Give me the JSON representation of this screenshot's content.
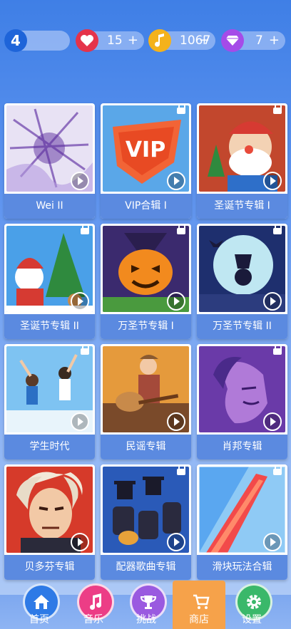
{
  "status": {
    "level": "4",
    "level_progress": 0.3,
    "lives": "15",
    "coins": "1067",
    "gems": "7",
    "plus": "+"
  },
  "albums": [
    {
      "title": "Wei II",
      "locked": false
    },
    {
      "title": "VIP合辑 I",
      "locked": true
    },
    {
      "title": "圣诞节专辑 I",
      "locked": true
    },
    {
      "title": "圣诞节专辑 II",
      "locked": true
    },
    {
      "title": "万圣节专辑 I",
      "locked": true
    },
    {
      "title": "万圣节专辑 II",
      "locked": true
    },
    {
      "title": "学生时代",
      "locked": true
    },
    {
      "title": "民谣专辑",
      "locked": false
    },
    {
      "title": "肖邦专辑",
      "locked": true
    },
    {
      "title": "贝多芬专辑",
      "locked": false
    },
    {
      "title": "配器歌曲专辑",
      "locked": true
    },
    {
      "title": "滑块玩法合辑",
      "locked": true
    }
  ],
  "cover_art": {
    "vip_text": "VIP"
  },
  "nav": {
    "home": "首页",
    "music": "音乐",
    "challenge": "挑战",
    "shop": "商店",
    "settings": "设置"
  },
  "colors": {
    "accent": "#5b8ae0",
    "active_tab": "#f6a24a",
    "heart": "#e5334a",
    "coin": "#f4b21b",
    "gem": "#a54be8"
  }
}
